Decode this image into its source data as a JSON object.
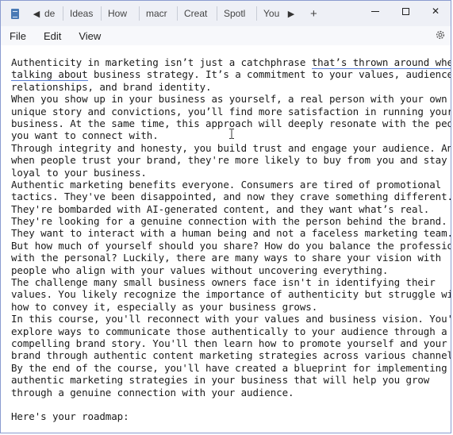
{
  "tabs": [
    "de",
    "Ideas",
    "How",
    "macr",
    "Creat",
    "Spotl",
    "You"
  ],
  "menu": [
    "File",
    "Edit",
    "View"
  ],
  "document": {
    "lines": [
      "Authenticity in marketing isn’t just a catchphrase that’s thrown around when",
      "talking about business strategy. It’s a commitment to your values, audience",
      "relationships, and brand identity.",
      "When you show up in your business as yourself, a real person with your own",
      "unique story and convictions, you’ll find more satisfaction in running your",
      "business. At the same time, this approach will deeply resonate with the people",
      "you want to connect with.",
      "Through integrity and honesty, you build trust and engage your audience. And",
      "when people trust your brand, they're more likely to buy from you and stay",
      "loyal to your business.",
      "Authentic marketing benefits everyone. Consumers are tired of promotional",
      "tactics. They've been disappointed, and now they crave something different.",
      "They're bombarded with AI-generated content, and they want what’s real.",
      "They're looking for a genuine connection with the person behind the brand.",
      "They want to interact with a human being and not a faceless marketing team.",
      "But how much of yourself should you share? How do you balance the professional",
      "with the personal? Luckily, there are many ways to share your vision with",
      "people who align with your values without uncovering everything.",
      "The challenge many small business owners face isn't in identifying their",
      "values. You likely recognize the importance of authenticity but struggle with",
      "how to convey it, especially as your business grows.",
      "In this course, you'll reconnect with your values and business vision. You'll",
      "explore ways to communicate those authentically to your audience through a",
      "compelling brand story. You'll then learn how to promote yourself and your",
      "brand through authentic content marketing strategies across various channels.",
      "By the end of the course, you'll have created a blueprint for implementing",
      "authentic marketing strategies in your business that will help you grow",
      "through a genuine connection with your audience.",
      "",
      "Here's your roadmap:"
    ]
  }
}
